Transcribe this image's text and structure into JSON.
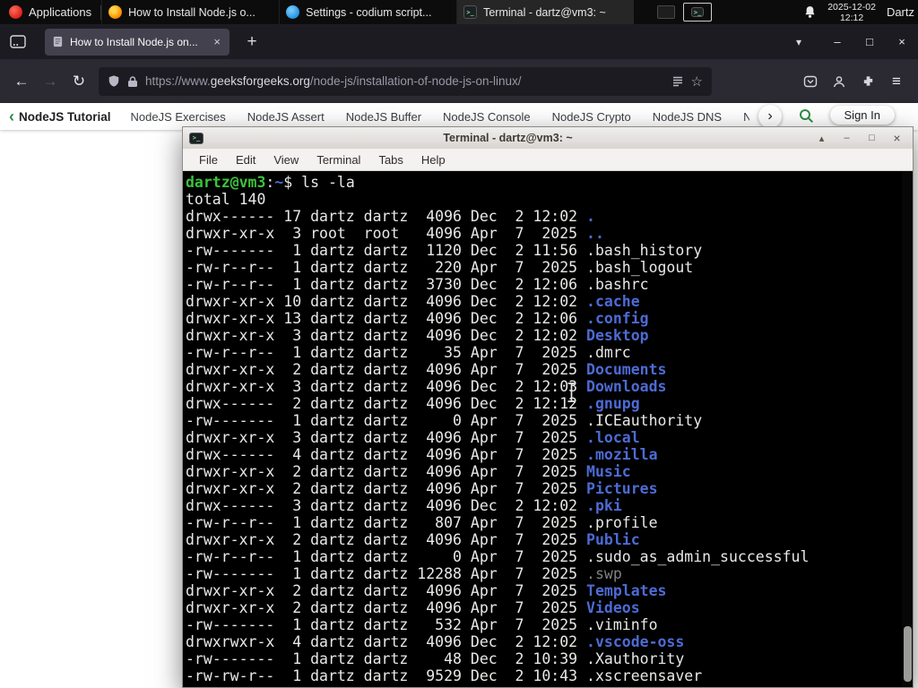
{
  "topbar": {
    "applications_label": "Applications",
    "tasks": [
      {
        "icon": "firefox",
        "label": "How to Install Node.js o...",
        "active": false
      },
      {
        "icon": "codium",
        "label": "Settings - codium script...",
        "active": false
      },
      {
        "icon": "terminal",
        "label": "Terminal - dartz@vm3: ~",
        "active": true
      }
    ],
    "clock_date": "2025-12-02",
    "clock_time": "12:12",
    "user_label": "Dartz"
  },
  "browser": {
    "tab_title": "How to Install Node.js on...",
    "url_prefix": "https://www.",
    "url_domain": "geeksforgeeks.org",
    "url_path": "/node-js/installation-of-node-js-on-linux/"
  },
  "site_nav": {
    "back_label": "NodeJS Tutorial",
    "links": [
      "NodeJS Exercises",
      "NodeJS Assert",
      "NodeJS Buffer",
      "NodeJS Console",
      "NodeJS Crypto",
      "NodeJS DNS",
      "Node"
    ],
    "sign_in_label": "Sign In"
  },
  "glyphs": {
    "back": "←",
    "forward": "→",
    "reload": "↻",
    "menu": "≡",
    "star": "☆",
    "tab_list": "▾",
    "minimize": "–",
    "maximize": "□",
    "close": "×",
    "new_tab": "+",
    "chev_left": "‹",
    "chev_right": "›",
    "shade": "▴",
    "term_glyph": ">_"
  },
  "terminal": {
    "title": "Terminal - dartz@vm3: ~",
    "menus": [
      "File",
      "Edit",
      "View",
      "Terminal",
      "Tabs",
      "Help"
    ],
    "prompt_user": "dartz@vm3",
    "prompt_colon": ":",
    "prompt_path": "~",
    "prompt_dollar": "$ ",
    "command": "ls -la",
    "total_line": "total 140",
    "listing": [
      {
        "meta": "drwx------ 17 dartz dartz  4096 Dec  2 12:02 ",
        "name": ".",
        "type": "dir"
      },
      {
        "meta": "drwxr-xr-x  3 root  root   4096 Apr  7  2025 ",
        "name": "..",
        "type": "dir"
      },
      {
        "meta": "-rw-------  1 dartz dartz  1120 Dec  2 11:56 ",
        "name": ".bash_history",
        "type": "file"
      },
      {
        "meta": "-rw-r--r--  1 dartz dartz   220 Apr  7  2025 ",
        "name": ".bash_logout",
        "type": "file"
      },
      {
        "meta": "-rw-r--r--  1 dartz dartz  3730 Dec  2 12:06 ",
        "name": ".bashrc",
        "type": "file"
      },
      {
        "meta": "drwxr-xr-x 10 dartz dartz  4096 Dec  2 12:02 ",
        "name": ".cache",
        "type": "dir"
      },
      {
        "meta": "drwxr-xr-x 13 dartz dartz  4096 Dec  2 12:06 ",
        "name": ".config",
        "type": "dir"
      },
      {
        "meta": "drwxr-xr-x  3 dartz dartz  4096 Dec  2 12:02 ",
        "name": "Desktop",
        "type": "dir"
      },
      {
        "meta": "-rw-r--r--  1 dartz dartz    35 Apr  7  2025 ",
        "name": ".dmrc",
        "type": "file"
      },
      {
        "meta": "drwxr-xr-x  2 dartz dartz  4096 Apr  7  2025 ",
        "name": "Documents",
        "type": "dir"
      },
      {
        "meta": "drwxr-xr-x  3 dartz dartz  4096 Dec  2 12:03 ",
        "name": "Downloads",
        "type": "dir"
      },
      {
        "meta": "drwx------  2 dartz dartz  4096 Dec  2 12:12 ",
        "name": ".gnupg",
        "type": "dir"
      },
      {
        "meta": "-rw-------  1 dartz dartz     0 Apr  7  2025 ",
        "name": ".ICEauthority",
        "type": "file"
      },
      {
        "meta": "drwxr-xr-x  3 dartz dartz  4096 Apr  7  2025 ",
        "name": ".local",
        "type": "dir"
      },
      {
        "meta": "drwx------  4 dartz dartz  4096 Apr  7  2025 ",
        "name": ".mozilla",
        "type": "dir"
      },
      {
        "meta": "drwxr-xr-x  2 dartz dartz  4096 Apr  7  2025 ",
        "name": "Music",
        "type": "dir"
      },
      {
        "meta": "drwxr-xr-x  2 dartz dartz  4096 Apr  7  2025 ",
        "name": "Pictures",
        "type": "dir"
      },
      {
        "meta": "drwx------  3 dartz dartz  4096 Dec  2 12:02 ",
        "name": ".pki",
        "type": "dir"
      },
      {
        "meta": "-rw-r--r--  1 dartz dartz   807 Apr  7  2025 ",
        "name": ".profile",
        "type": "file"
      },
      {
        "meta": "drwxr-xr-x  2 dartz dartz  4096 Apr  7  2025 ",
        "name": "Public",
        "type": "dir"
      },
      {
        "meta": "-rw-r--r--  1 dartz dartz     0 Apr  7  2025 ",
        "name": ".sudo_as_admin_successful",
        "type": "file"
      },
      {
        "meta": "-rw-------  1 dartz dartz 12288 Apr  7  2025 ",
        "name": ".swp",
        "type": "dim"
      },
      {
        "meta": "drwxr-xr-x  2 dartz dartz  4096 Apr  7  2025 ",
        "name": "Templates",
        "type": "dir"
      },
      {
        "meta": "drwxr-xr-x  2 dartz dartz  4096 Apr  7  2025 ",
        "name": "Videos",
        "type": "dir"
      },
      {
        "meta": "-rw-------  1 dartz dartz   532 Apr  7  2025 ",
        "name": ".viminfo",
        "type": "file"
      },
      {
        "meta": "drwxrwxr-x  4 dartz dartz  4096 Dec  2 12:02 ",
        "name": ".vscode-oss",
        "type": "dir"
      },
      {
        "meta": "-rw-------  1 dartz dartz    48 Dec  2 10:39 ",
        "name": ".Xauthority",
        "type": "file"
      },
      {
        "meta": "-rw-rw-r--  1 dartz dartz  9529 Dec  2 10:43 ",
        "name": ".xscreensaver",
        "type": "file"
      }
    ]
  }
}
